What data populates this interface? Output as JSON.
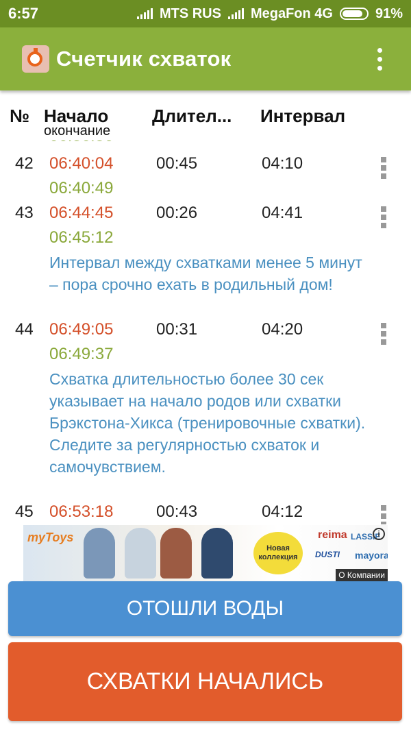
{
  "status_bar": {
    "time": "6:57",
    "carrier1": "MTS RUS",
    "carrier2": "MegaFon 4G",
    "battery": "91%"
  },
  "app_bar": {
    "title": "Счетчик схваток",
    "icon": "stopwatch-logo-icon",
    "menu_icon": "more-vert-icon"
  },
  "table_header": {
    "num": "№",
    "start": "Начало",
    "start_sub": "окончание",
    "duration": "Длител...",
    "interval": "Интервал"
  },
  "rows": [
    {
      "num": "42",
      "start": "06:40:04",
      "end": "06:40:49",
      "duration": "00:45",
      "interval": "04:10",
      "note": ""
    },
    {
      "num": "43",
      "start": "06:44:45",
      "end": "06:45:12",
      "duration": "00:26",
      "interval": "04:41",
      "note": "Интервал между схватками менее 5 минут – пора срочно ехать в родильный дом!"
    },
    {
      "num": "44",
      "start": "06:49:05",
      "end": "06:49:37",
      "duration": "00:31",
      "interval": "04:20",
      "note": "Схватка длительностью более 30 сек указывает на начало родов или схватки Брэкстона-Хикса (тренировочные схватки). Следите за регулярностью схваток и самочувствием."
    },
    {
      "num": "45",
      "start": "06:53:18",
      "end": "",
      "duration": "00:43",
      "interval": "04:12",
      "note": ""
    }
  ],
  "ad": {
    "brand": "myToys",
    "badge": "Новая коллекция",
    "brands": [
      "reima",
      "LASSIE",
      "DUSTI",
      "mayoral"
    ],
    "info": "i",
    "about": "О Компании"
  },
  "buttons": {
    "water": "ОТОШЛИ ВОДЫ",
    "contractions": "СХВАТКИ НАЧАЛИСЬ"
  },
  "colors": {
    "status_bar": "#6b8e23",
    "app_bar": "#8bb03c",
    "start_time": "#d4502a",
    "end_time": "#8aa83a",
    "note": "#4a90c0",
    "water_button": "#4b90d2",
    "contractions_button": "#e25c2c"
  }
}
